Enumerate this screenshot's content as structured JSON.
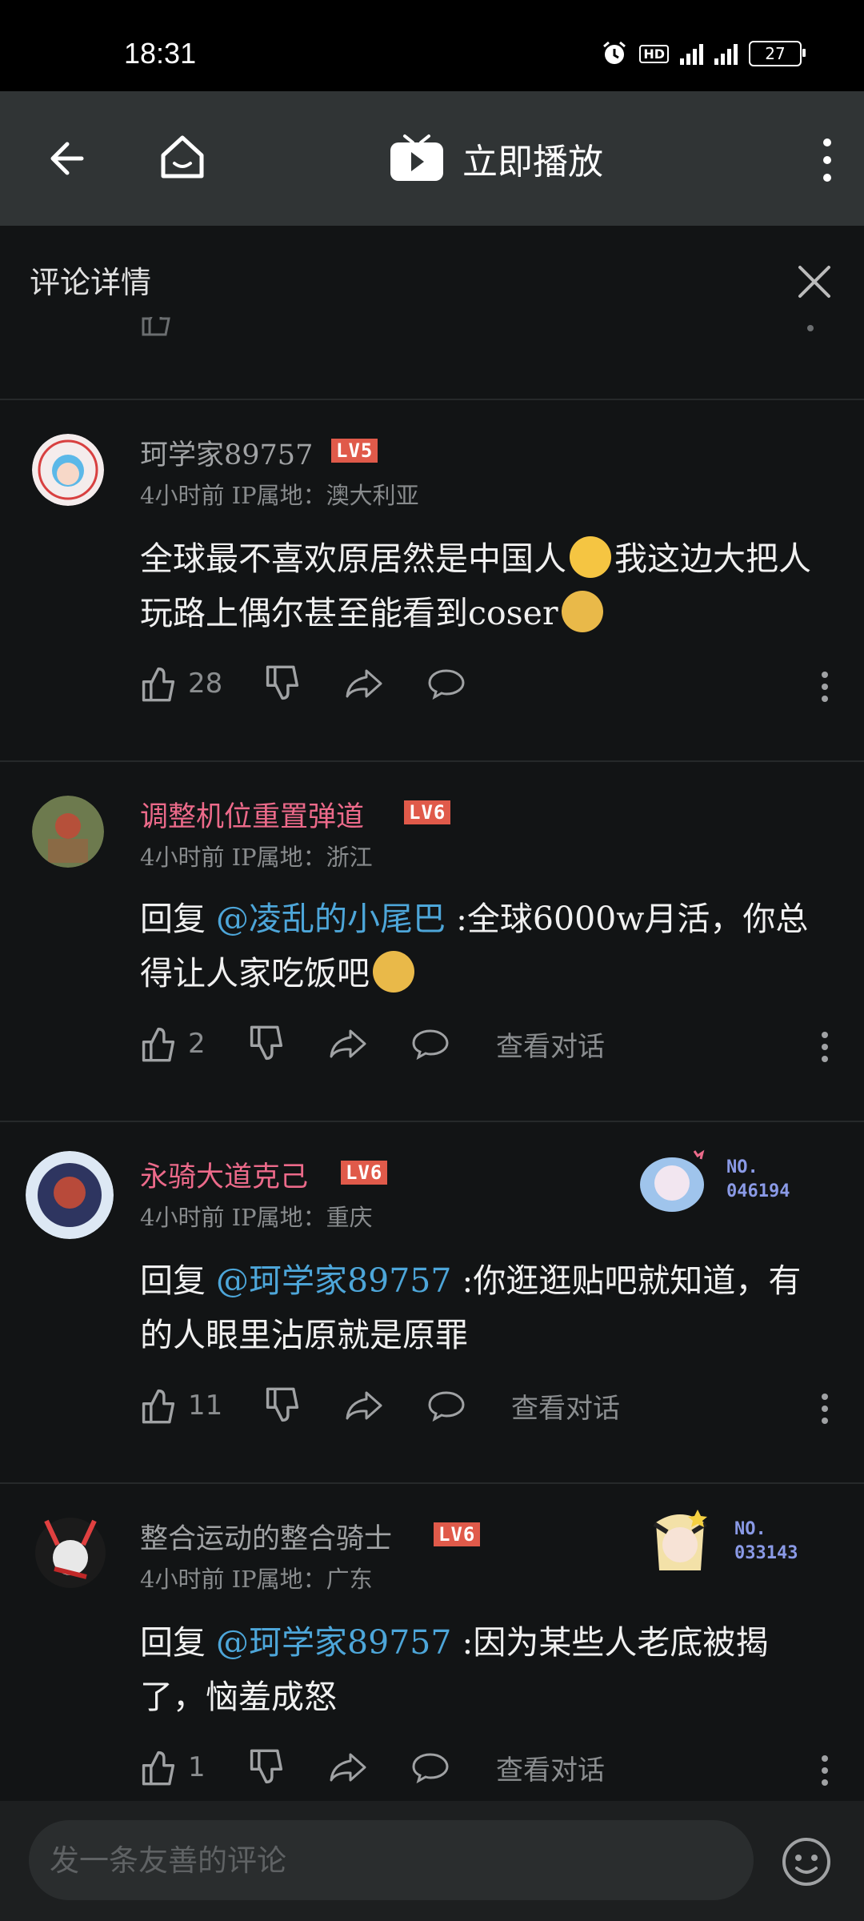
{
  "status_bar": {
    "time": "18:31",
    "hd": "HD",
    "network": "4G 5G",
    "battery": "27"
  },
  "app_bar": {
    "title": "立即播放"
  },
  "panel": {
    "title": "评论详情"
  },
  "comments": [
    {
      "username": "珂学家89757",
      "level": "LV5",
      "meta": "4小时前  IP属地：澳大利亚",
      "text_before": "全球最不喜欢原居然是中国人",
      "text_after": "我这边大把人玩路上偶尔甚至能看到coser",
      "likes": "28"
    },
    {
      "username": "调整机位重置弹道",
      "level": "LV6",
      "meta": "4小时前  IP属地：浙江",
      "reply_prefix": "回复 ",
      "mention": "@凌乱的小尾巴",
      "text": " :全球6000w月活，你总得让人家吃饭吧",
      "likes": "2",
      "view_thread": "查看对话"
    },
    {
      "username": "永骑大道克己",
      "level": "LV6",
      "meta": "4小时前  IP属地：重庆",
      "reply_prefix": "回复 ",
      "mention": "@珂学家89757",
      "text": " :你逛逛贴吧就知道，有的人眼里沾原就是原罪",
      "likes": "11",
      "view_thread": "查看对话",
      "badge_no_label": "NO.",
      "badge_no": "046194"
    },
    {
      "username": "整合运动的整合骑士",
      "level": "LV6",
      "meta": "4小时前  IP属地：广东",
      "reply_prefix": "回复 ",
      "mention": "@珂学家89757",
      "text": " :因为某些人老底被揭了，恼羞成怒",
      "likes": "1",
      "view_thread": "查看对话",
      "badge_no_label": "NO.",
      "badge_no": "033143"
    }
  ],
  "bottom": {
    "placeholder": "发一条友善的评论"
  },
  "colors": {
    "background": "#121415",
    "app_bar": "#303435",
    "mention": "#4da6d9",
    "level_badge": "#e05a4a",
    "pink_name": "#ec6a8a"
  }
}
